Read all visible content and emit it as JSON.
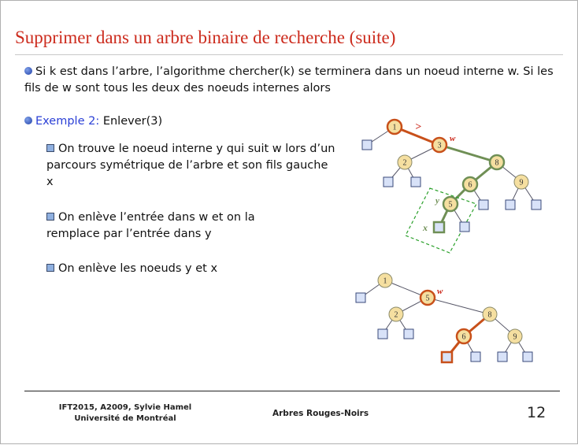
{
  "title": "Supprimer dans un arbre binaire de recherche (suite)",
  "bullet1": "Si k est dans l’arbre, l’algorithme chercher(k) se terminera dans un noeud interne w. Si les fils de w sont tous les deux des noeuds internes alors",
  "example_label": "Exemple 2:",
  "example_text": "Enlever(3)",
  "subs": [
    "On trouve le noeud interne y qui suit w lors d’un parcours symétrique de l’arbre et son fils gauche x",
    "On enlève l’entrée dans w et on la remplace par l’entrée dans y",
    "On enlève les noeuds y et x"
  ],
  "tree_top": {
    "nodes": [
      "1",
      "3",
      "2",
      "8",
      "6",
      "9",
      "5"
    ],
    "labels": {
      "w": "w",
      "gt": ">",
      "y": "y",
      "x": "x"
    }
  },
  "tree_bottom": {
    "nodes": [
      "1",
      "5",
      "2",
      "8",
      "6",
      "9"
    ],
    "labels": {
      "w": "w"
    }
  },
  "colors": {
    "title": "#cc2b1d",
    "example": "#2a3fd6",
    "node_fill": "#f5dfa0",
    "leaf_fill": "#d8e2f8",
    "path_orange": "#c8501a",
    "path_green": "#6f8f55"
  },
  "footer": {
    "course": "IFT2015, A2009, Sylvie Hamel",
    "university": "Université de Montréal",
    "topic": "Arbres Rouges-Noirs",
    "page": "12"
  }
}
